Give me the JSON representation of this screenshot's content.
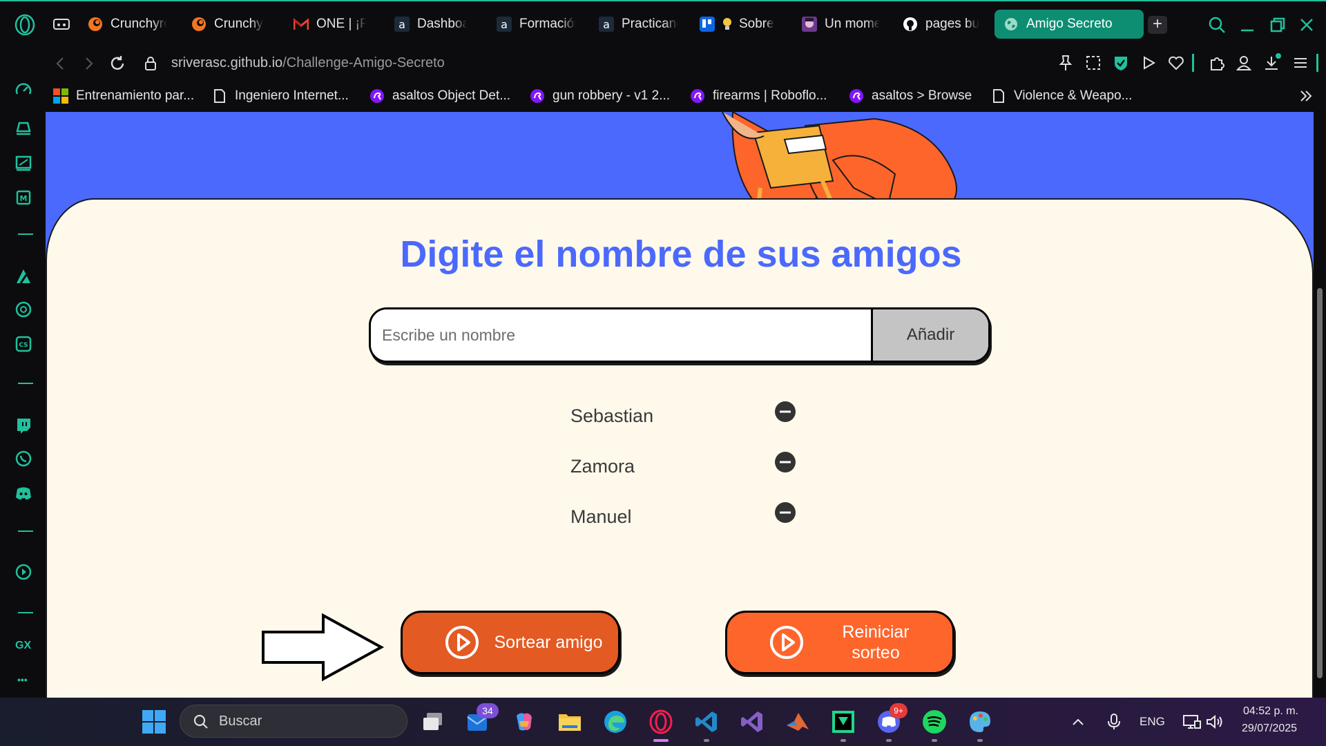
{
  "browser": {
    "tabs": [
      {
        "label": "Crunchyroll",
        "icon": "crunchyroll-icon"
      },
      {
        "label": "Crunchyroll",
        "icon": "crunchyroll-icon"
      },
      {
        "label": "ONE | ¡Felicidades",
        "icon": "gmail-icon"
      },
      {
        "label": "Dashboard",
        "icon": "alura-icon"
      },
      {
        "label": "Formación",
        "icon": "alura-icon"
      },
      {
        "label": "Practicando",
        "icon": "alura-icon"
      },
      {
        "label": "Sobre",
        "icon": "trello-icon"
      },
      {
        "label": "Un momento",
        "icon": "anime-icon"
      },
      {
        "label": "pages build",
        "icon": "github-icon"
      },
      {
        "label": "Amigo Secreto",
        "icon": "globe-icon"
      }
    ],
    "url_host": "sriverasc.github.io",
    "url_path": "/Challenge-Amigo-Secreto"
  },
  "bookmarks": [
    {
      "label": "Entrenamiento par...",
      "icon": "microsoft-icon"
    },
    {
      "label": "Ingeniero Internet...",
      "icon": "page-icon"
    },
    {
      "label": "asaltos Object Det...",
      "icon": "roboflow-icon"
    },
    {
      "label": "gun robbery - v1 2...",
      "icon": "roboflow-icon"
    },
    {
      "label": "firearms | Roboflo...",
      "icon": "roboflow-icon"
    },
    {
      "label": "asaltos > Browse",
      "icon": "roboflow-icon"
    },
    {
      "label": "Violence & Weapo...",
      "icon": "page-icon"
    }
  ],
  "sidebar": {
    "gx_label": "GX",
    "more_label": "•••"
  },
  "page": {
    "heading": "Digite el nombre de sus amigos",
    "input_placeholder": "Escribe un nombre",
    "add_button": "Añadir",
    "friends": [
      "Sebastian",
      "Zamora",
      "Manuel"
    ],
    "draw_button": "Sortear amigo",
    "reset_button": "Reiniciar sorteo"
  },
  "colors": {
    "accent_blue": "#4b69fd",
    "button_orange": "#fe652b",
    "card_bg": "#fff9eb",
    "opera_teal": "#20c19d"
  },
  "taskbar": {
    "search_label": "Buscar",
    "mail_badge": "34",
    "discord_badge": "9+",
    "language": "ENG",
    "time": "04:52 p. m.",
    "date": "29/07/2025"
  }
}
